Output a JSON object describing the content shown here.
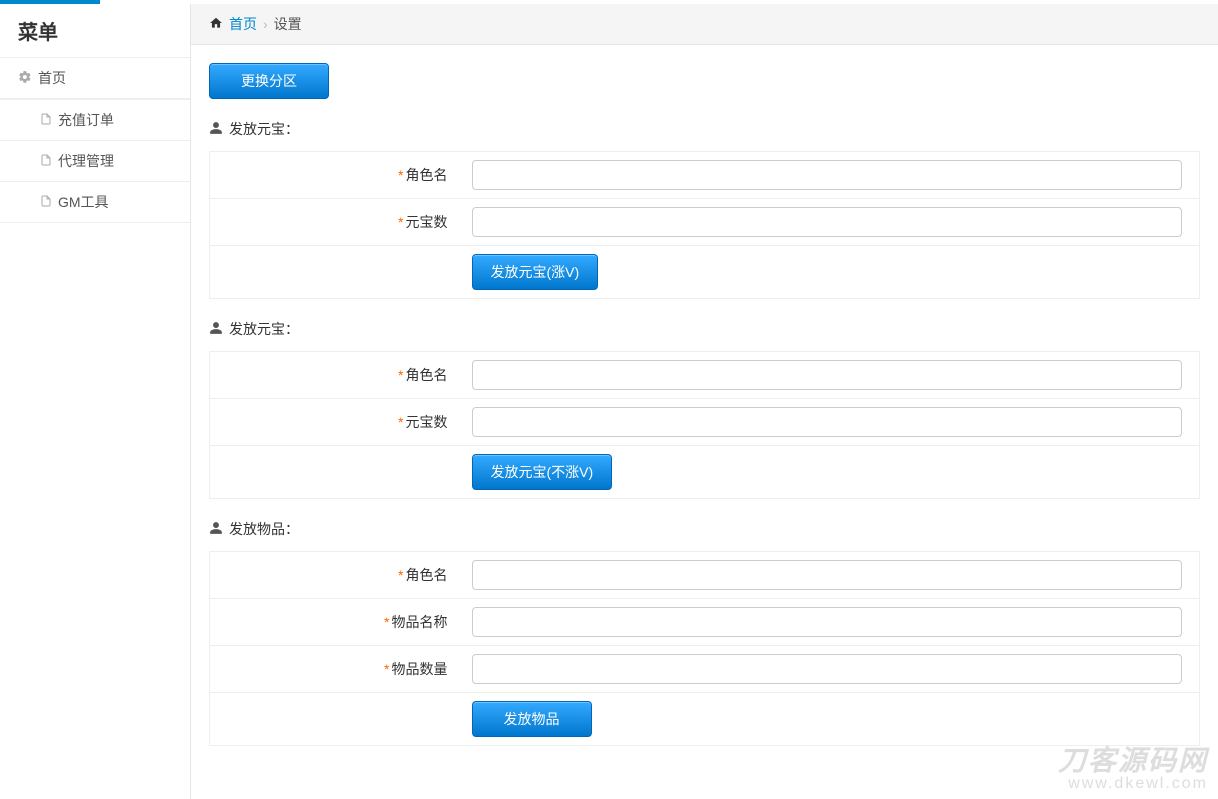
{
  "sidebar": {
    "title": "菜单",
    "home_label": "首页",
    "items": [
      {
        "label": "充值订单"
      },
      {
        "label": "代理管理"
      },
      {
        "label": "GM工具"
      }
    ]
  },
  "breadcrumb": {
    "home": "首页",
    "current": "设置"
  },
  "top_button": "更换分区",
  "sections": {
    "give_yuanbao_vip": {
      "title": "发放元宝：",
      "fields": {
        "role_name": "角色名",
        "amount": "元宝数"
      },
      "submit": "发放元宝(涨V)"
    },
    "give_yuanbao_novip": {
      "title": "发放元宝：",
      "fields": {
        "role_name": "角色名",
        "amount": "元宝数"
      },
      "submit": "发放元宝(不涨V)"
    },
    "give_item": {
      "title": "发放物品：",
      "fields": {
        "role_name": "角色名",
        "item_name": "物品名称",
        "item_qty": "物品数量"
      },
      "submit": "发放物品"
    }
  },
  "watermark": {
    "line1": "刀客源码网",
    "line2": "www.dkewl.com"
  }
}
